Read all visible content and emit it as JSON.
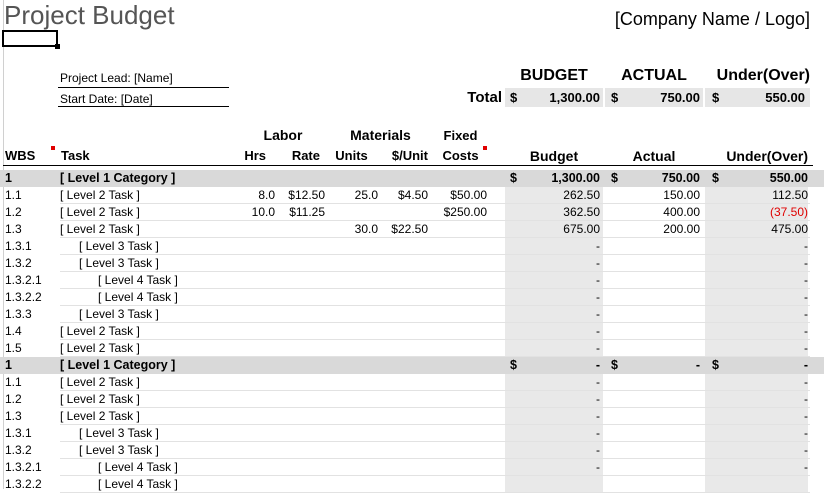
{
  "title": "Project Budget",
  "company": "[Company Name / Logo]",
  "info": {
    "lead": "Project Lead: [Name]",
    "start": "Start Date: [Date]"
  },
  "summary": {
    "headers": {
      "budget": "BUDGET",
      "actual": "ACTUAL",
      "underover": "Under(Over)"
    },
    "total_label": "Total",
    "currency": "$",
    "budget": "1,300.00",
    "actual": "750.00",
    "underover": "550.00"
  },
  "columns": {
    "wbs": "WBS",
    "task": "Task",
    "labor": "Labor",
    "hrs": "Hrs",
    "rate": "Rate",
    "materials": "Materials",
    "units": "Units",
    "unitcost": "$/Unit",
    "fixed1": "Fixed",
    "fixed2": "Costs",
    "budget": "Budget",
    "actual": "Actual",
    "underover": "Under(Over)"
  },
  "rows": [
    {
      "type": "cat",
      "wbs": "1",
      "task": "[ Level 1 Category ]",
      "indent": 0,
      "hrs": "",
      "rate": "",
      "units": "",
      "unitcost": "",
      "fixed": "",
      "cur": "$",
      "budget": "1,300.00",
      "actual": "750.00",
      "uo": "550.00",
      "neg": false
    },
    {
      "type": "task",
      "wbs": "1.1",
      "task": "[ Level 2 Task ]",
      "indent": 0,
      "hrs": "8.0",
      "rate": "$12.50",
      "units": "25.0",
      "unitcost": "$4.50",
      "fixed": "$50.00",
      "budget": "262.50",
      "actual": "150.00",
      "uo": "112.50",
      "neg": false
    },
    {
      "type": "task",
      "wbs": "1.2",
      "task": "[ Level 2 Task ]",
      "indent": 0,
      "hrs": "10.0",
      "rate": "$11.25",
      "units": "",
      "unitcost": "",
      "fixed": "$250.00",
      "budget": "362.50",
      "actual": "400.00",
      "uo": "(37.50)",
      "neg": true
    },
    {
      "type": "task",
      "wbs": "1.3",
      "task": "[ Level 2 Task ]",
      "indent": 0,
      "hrs": "",
      "rate": "",
      "units": "30.0",
      "unitcost": "$22.50",
      "fixed": "",
      "budget": "675.00",
      "actual": "200.00",
      "uo": "475.00",
      "neg": false
    },
    {
      "type": "task",
      "wbs": "1.3.1",
      "task": "[ Level 3 Task ]",
      "indent": 1,
      "hrs": "",
      "rate": "",
      "units": "",
      "unitcost": "",
      "fixed": "",
      "budget": "-",
      "actual": "",
      "uo": "-",
      "neg": false
    },
    {
      "type": "task",
      "wbs": "1.3.2",
      "task": "[ Level 3 Task ]",
      "indent": 1,
      "hrs": "",
      "rate": "",
      "units": "",
      "unitcost": "",
      "fixed": "",
      "budget": "-",
      "actual": "",
      "uo": "-",
      "neg": false
    },
    {
      "type": "task",
      "wbs": "1.3.2.1",
      "task": "[ Level 4 Task ]",
      "indent": 2,
      "hrs": "",
      "rate": "",
      "units": "",
      "unitcost": "",
      "fixed": "",
      "budget": "-",
      "actual": "",
      "uo": "-",
      "neg": false
    },
    {
      "type": "task",
      "wbs": "1.3.2.2",
      "task": "[ Level 4 Task ]",
      "indent": 2,
      "hrs": "",
      "rate": "",
      "units": "",
      "unitcost": "",
      "fixed": "",
      "budget": "-",
      "actual": "",
      "uo": "-",
      "neg": false
    },
    {
      "type": "task",
      "wbs": "1.3.3",
      "task": "[ Level 3 Task ]",
      "indent": 1,
      "hrs": "",
      "rate": "",
      "units": "",
      "unitcost": "",
      "fixed": "",
      "budget": "-",
      "actual": "",
      "uo": "-",
      "neg": false
    },
    {
      "type": "task",
      "wbs": "1.4",
      "task": "[ Level 2 Task ]",
      "indent": 0,
      "hrs": "",
      "rate": "",
      "units": "",
      "unitcost": "",
      "fixed": "",
      "budget": "-",
      "actual": "",
      "uo": "-",
      "neg": false
    },
    {
      "type": "task",
      "wbs": "1.5",
      "task": "[ Level 2 Task ]",
      "indent": 0,
      "hrs": "",
      "rate": "",
      "units": "",
      "unitcost": "",
      "fixed": "",
      "budget": "-",
      "actual": "",
      "uo": "-",
      "neg": false
    },
    {
      "type": "cat",
      "wbs": "1",
      "task": "[ Level 1 Category ]",
      "indent": 0,
      "hrs": "",
      "rate": "",
      "units": "",
      "unitcost": "",
      "fixed": "",
      "cur": "$",
      "budget": "-",
      "actual": "-",
      "uo": "-",
      "neg": false
    },
    {
      "type": "task",
      "wbs": "1.1",
      "task": "[ Level 2 Task ]",
      "indent": 0,
      "hrs": "",
      "rate": "",
      "units": "",
      "unitcost": "",
      "fixed": "",
      "budget": "-",
      "actual": "",
      "uo": "-",
      "neg": false
    },
    {
      "type": "task",
      "wbs": "1.2",
      "task": "[ Level 2 Task ]",
      "indent": 0,
      "hrs": "",
      "rate": "",
      "units": "",
      "unitcost": "",
      "fixed": "",
      "budget": "-",
      "actual": "",
      "uo": "-",
      "neg": false
    },
    {
      "type": "task",
      "wbs": "1.3",
      "task": "[ Level 2 Task ]",
      "indent": 0,
      "hrs": "",
      "rate": "",
      "units": "",
      "unitcost": "",
      "fixed": "",
      "budget": "-",
      "actual": "",
      "uo": "-",
      "neg": false
    },
    {
      "type": "task",
      "wbs": "1.3.1",
      "task": "[ Level 3 Task ]",
      "indent": 1,
      "hrs": "",
      "rate": "",
      "units": "",
      "unitcost": "",
      "fixed": "",
      "budget": "-",
      "actual": "",
      "uo": "-",
      "neg": false
    },
    {
      "type": "task",
      "wbs": "1.3.2",
      "task": "[ Level 3 Task ]",
      "indent": 1,
      "hrs": "",
      "rate": "",
      "units": "",
      "unitcost": "",
      "fixed": "",
      "budget": "-",
      "actual": "",
      "uo": "-",
      "neg": false
    },
    {
      "type": "task",
      "wbs": "1.3.2.1",
      "task": "[ Level 4 Task ]",
      "indent": 2,
      "hrs": "",
      "rate": "",
      "units": "",
      "unitcost": "",
      "fixed": "",
      "budget": "-",
      "actual": "",
      "uo": "-",
      "neg": false
    },
    {
      "type": "task",
      "wbs": "1.3.2.2",
      "task": "[ Level 4 Task ]",
      "indent": 2,
      "hrs": "",
      "rate": "",
      "units": "",
      "unitcost": "",
      "fixed": "",
      "budget": "",
      "actual": "",
      "uo": "",
      "neg": false
    }
  ]
}
